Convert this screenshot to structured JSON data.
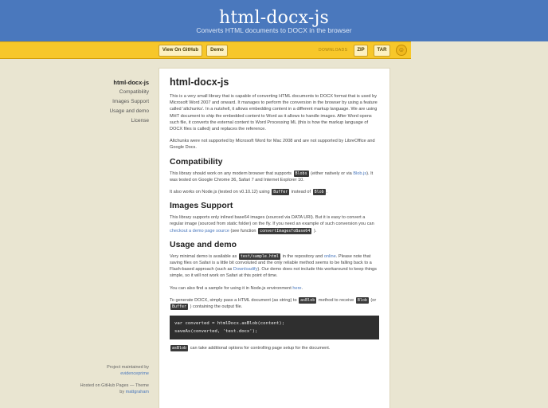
{
  "header": {
    "title": "html-docx-js",
    "subtitle": "Converts HTML documents to DOCX in the browser"
  },
  "toolbar": {
    "github_label": "View On GitHub",
    "demo_label": "Demo",
    "downloads_label": "DOWNLOADS",
    "zip_label": "ZIP",
    "tar_label": "TAR",
    "logo_icon": "octocat-icon"
  },
  "sidebar": {
    "items": [
      {
        "label": "html-docx-js"
      },
      {
        "label": "Compatibility"
      },
      {
        "label": "Images Support"
      },
      {
        "label": "Usage and demo"
      },
      {
        "label": "License"
      }
    ],
    "footer": {
      "maintained": "Project maintained by",
      "maintainer": "evidenceprime",
      "hosted": "Hosted on GitHub Pages — Theme",
      "by": "by",
      "theme_author": "mattgraham"
    }
  },
  "content": {
    "title": "html-docx-js",
    "intro": "This is a very small library that is capable of converting HTML documents to DOCX format that is used by Microsoft Word 2007 and onward. It manages to perform the conversion in the browser by using a feature called 'altchunks'. In a nutshell, it allows embedding content in a different markup language. We are using MHT document to ship the embedded content to Word as it allows to handle images. After Word opens such file, it converts the external content to Word Processing ML (this is how the markup language of DOCX files is called) and replaces the reference.",
    "altchunks_note": "Altchunks were not supported by Microsoft Word for Mac 2008 and are not supported by LibreOffice and Google Docs.",
    "compat": {
      "heading": "Compatibility",
      "p1_a": "This library should work on any modern browser that supports",
      "blobs": "Blobs",
      "p1_b": "(either natively or via",
      "blobjs": "Blob.js",
      "p1_c": "). It was tested on Google Chrome 36, Safari 7 and Internet Explorer 10.",
      "p2_a": "It also works on Node.js (tested on v0.10.12) using",
      "buffer": "Buffer",
      "p2_b": "instead of",
      "blob": "Blob",
      "p2_c": "."
    },
    "images": {
      "heading": "Images Support",
      "p_a": "This library supports only inlined base64 images (sourced via DATA URI). But it is easy to convert a regular image (sourced from static folder) on the fly. If you need an example of such conversion you can",
      "demo_link": "checkout a demo page source",
      "p_b": "(see function",
      "fn": "convertImagesToBase64",
      "p_c": ")."
    },
    "usage": {
      "heading": "Usage and demo",
      "p1_a": "Very minimal demo is available as",
      "sample": "test/sample.html",
      "p1_b": "in the repository and",
      "online": "online",
      "p1_c": ". Please note that saving files on Safari is a little bit convoluted and the only reliable method seems to be falling back to a Flash-based approach (such as",
      "downloadify": "Downloadify",
      "p1_d": "). Our demo does not include this workaround to keep things simple, so it will not work on Safari at this point of time.",
      "p2_a": "You can also find a sample for using it in Node.js environment",
      "here": "here",
      "p2_b": ".",
      "p3_a": "To generate DOCX, simply pass a HTML document (as string) to",
      "asblob": "asBlob",
      "p3_b": "method to receive",
      "blob": "Blob",
      "p3_c": "(or",
      "buffer": "Buffer",
      "p3_d": ") containing the output file.",
      "code_line1": "var converted = htmlDocx.asBlob(content);",
      "code_line2": "saveAs(converted, 'test.docx');",
      "p4_code": "asBlob",
      "p4_rest": "can take additional options for controlling page setup for the document."
    }
  }
}
